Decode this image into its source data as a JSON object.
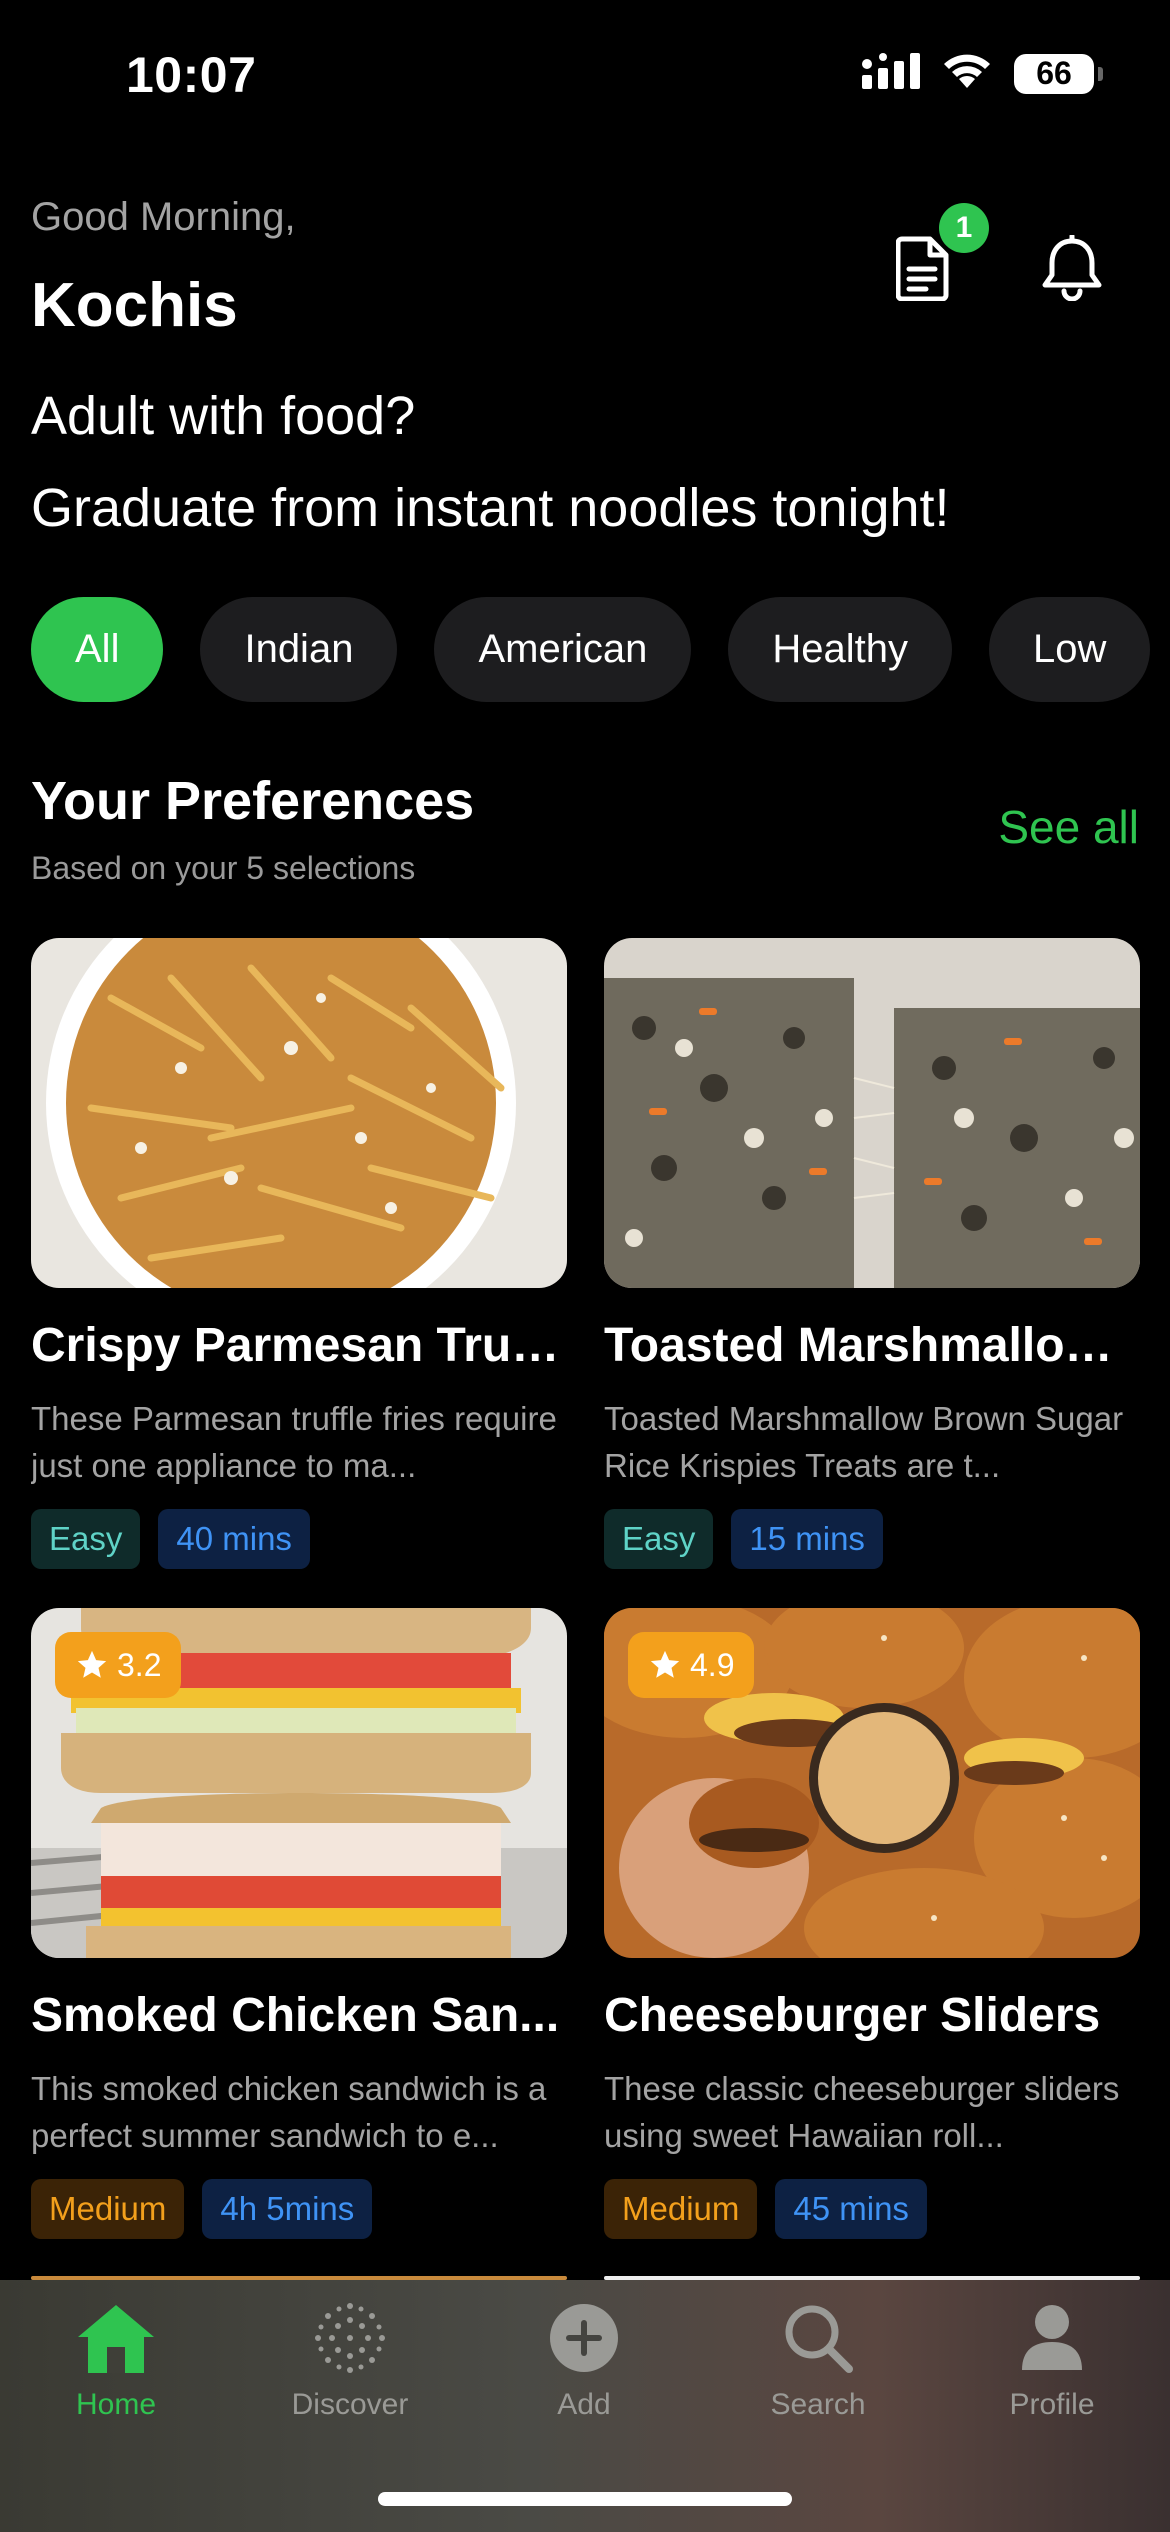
{
  "status": {
    "time": "10:07",
    "battery": "66"
  },
  "header": {
    "greeting": "Good Morning,",
    "name": "Kochis",
    "badge_count": "1",
    "headline_1": "Adult with food?",
    "headline_2": "Graduate from instant noodles tonight!"
  },
  "chips": [
    "All",
    "Indian",
    "American",
    "Healthy",
    "Low"
  ],
  "section": {
    "title": "Your Preferences",
    "subtitle": "Based on your 5 selections",
    "see_all": "See all"
  },
  "recipes": [
    {
      "title": "Crispy Parmesan Truf...",
      "description": "These Parmesan truffle fries require just one appliance to ma...",
      "difficulty": "Easy",
      "time": "40 mins",
      "rating": ""
    },
    {
      "title": "Toasted Marshmallow...",
      "description": "Toasted Marshmallow Brown Sugar Rice Krispies Treats are t...",
      "difficulty": "Easy",
      "time": "15 mins",
      "rating": ""
    },
    {
      "title": "Smoked Chicken San...",
      "description": "This smoked chicken sandwich is a perfect summer sandwich to e...",
      "difficulty": "Medium",
      "time": "4h 5mins",
      "rating": "3.2"
    },
    {
      "title": "Cheeseburger Sliders",
      "description": "These classic cheeseburger sliders using sweet Hawaiian roll...",
      "difficulty": "Medium",
      "time": "45 mins",
      "rating": "4.9"
    }
  ],
  "tabs": [
    "Home",
    "Discover",
    "Add",
    "Search",
    "Profile"
  ],
  "colors": {
    "accent": "#2fc450",
    "rating": "#f3a01c",
    "background": "#000000"
  },
  "icons": [
    "signal-icon",
    "wifi-icon",
    "battery-icon",
    "document-icon",
    "bell-icon",
    "star-icon",
    "home-icon",
    "discover-icon",
    "add-icon",
    "search-icon",
    "profile-icon"
  ]
}
